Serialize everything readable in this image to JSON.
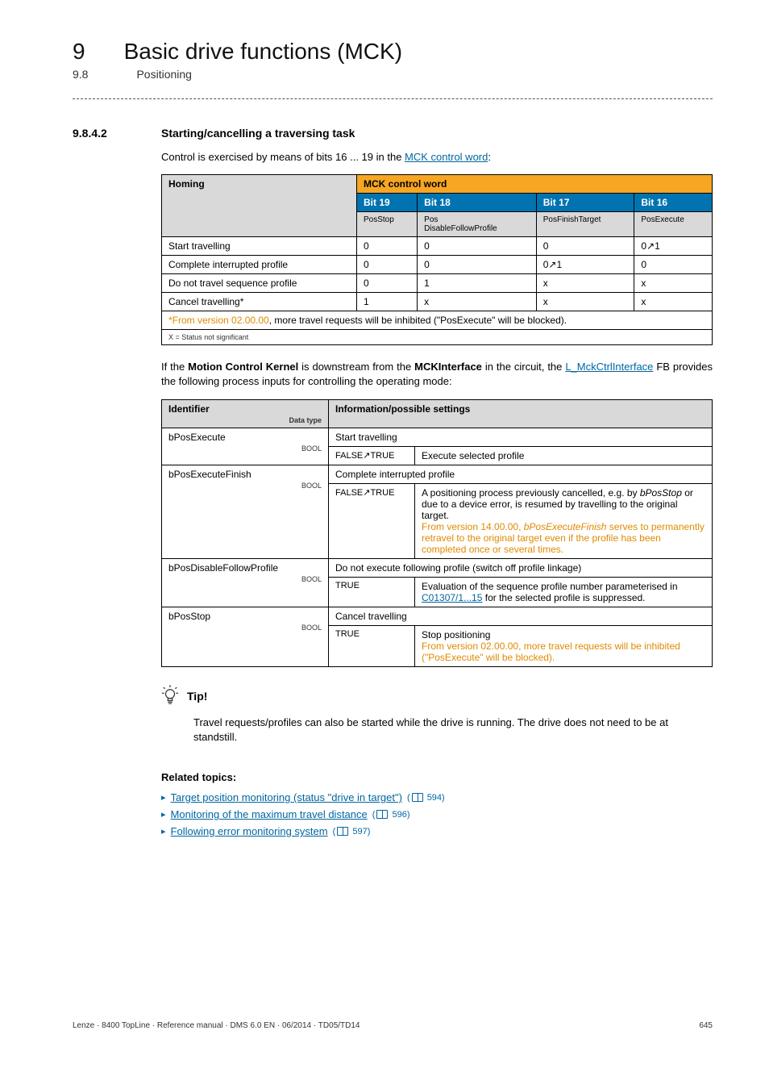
{
  "chapter": {
    "num": "9",
    "title": "Basic drive functions (MCK)"
  },
  "sub": {
    "num": "9.8",
    "title": "Positioning"
  },
  "section": {
    "num": "9.8.4.2",
    "heading": "Starting/cancelling a traversing task"
  },
  "intro": {
    "pre": "Control is exercised by means of bits 16 ... 19 in the ",
    "link": "MCK control word",
    "post": ":"
  },
  "table1": {
    "row_label": "Homing",
    "ctrl_head": "MCK control word",
    "bits": [
      "Bit 19",
      "Bit 18",
      "Bit 17",
      "Bit 16"
    ],
    "subs": [
      "PosStop",
      "Pos\nDisableFollowProfile",
      "PosFinishTarget",
      "PosExecute"
    ],
    "rows": [
      {
        "label": "Start travelling",
        "cells": [
          "0",
          "0",
          "0",
          "0↗1"
        ]
      },
      {
        "label": "Complete interrupted profile",
        "cells": [
          "0",
          "0",
          "0↗1",
          "0"
        ]
      },
      {
        "label": "Do not travel sequence profile",
        "cells": [
          "0",
          "1",
          "x",
          "x"
        ]
      },
      {
        "label": "Cancel travelling*",
        "cells": [
          "1",
          "x",
          "x",
          "x"
        ]
      }
    ],
    "note_star": "*",
    "note_pre": "From version 02.00.00",
    "note_rest": ", more travel requests will be inhibited (\"PosExecute\" will be blocked).",
    "xnote": "X = Status not significant"
  },
  "para2": {
    "pre": "If the ",
    "b1": "Motion Control Kernel",
    "mid": " is downstream from the ",
    "b2": "MCKInterface",
    "post1": " in the circuit, the ",
    "link": "L_MckCtrlInterface",
    "post2": " FB provides the following process inputs for controlling the operating mode:"
  },
  "table2": {
    "head_id": "Identifier",
    "head_id_sub": "Data type",
    "head_info": "Information/possible settings",
    "rows": [
      {
        "id": "bPosExecute",
        "dtype": "BOOL",
        "title": "Start travelling",
        "sub": [
          {
            "tf": "FALSE↗TRUE",
            "txt": "Execute selected profile"
          }
        ]
      },
      {
        "id": "bPosExecuteFinish",
        "dtype": "BOOL",
        "title": "Complete interrupted profile",
        "sub": [
          {
            "tf": "FALSE↗TRUE",
            "txt_pre": "A positioning process previously cancelled, e.g. by ",
            "txt_i": "bPosStop",
            "txt_mid": " or due to a device error, is resumed by travelling to the original target.",
            "txt_orange_pre": "From version 14.00.00",
            "txt_orange_mid_i": "bPosExecuteFinish",
            "txt_orange_post": " serves to permanently retravel to the original target even if the profile has been completed once or several times."
          }
        ]
      },
      {
        "id": "bPosDisableFollowProfile",
        "dtype": "BOOL",
        "title": "Do not execute following profile (switch off profile linkage)",
        "sub": [
          {
            "tf": "TRUE",
            "txt_pre": "Evaluation of the sequence profile number parameterised in ",
            "txt_link": "C01307/1...15",
            "txt_post": " for the selected profile is suppressed."
          }
        ]
      },
      {
        "id": "bPosStop",
        "dtype": "BOOL",
        "title": "Cancel travelling",
        "sub": [
          {
            "tf": "TRUE",
            "txt_line1": "Stop positioning",
            "txt_orange_pre": "From version 02.00.00",
            "txt_orange_post": ", more travel requests will be inhibited (\"PosExecute\" will be blocked)."
          }
        ]
      }
    ]
  },
  "tip": {
    "label": "Tip!",
    "body": "Travel requests/profiles can also be started while the drive is running. The drive does not need to be at standstill."
  },
  "related": {
    "heading": "Related topics:",
    "items": [
      {
        "text": "Target position monitoring (status \"drive in target\")",
        "page": "594"
      },
      {
        "text": "Monitoring of the maximum travel distance",
        "page": "596"
      },
      {
        "text": "Following error monitoring system",
        "page": "597"
      }
    ]
  },
  "footer": {
    "left": "Lenze · 8400 TopLine · Reference manual · DMS 6.0 EN · 06/2014 · TD05/TD14",
    "right": "645"
  }
}
